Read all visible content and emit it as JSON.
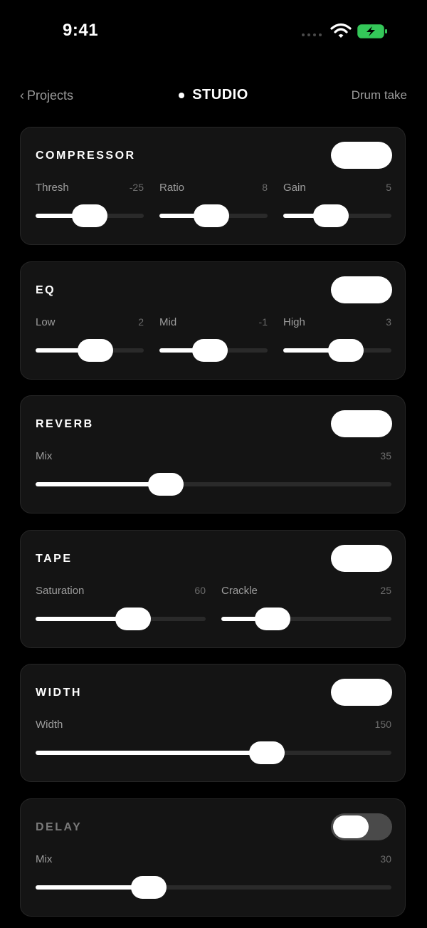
{
  "status_bar": {
    "time": "9:41"
  },
  "nav": {
    "back_label": "Projects",
    "title": "STUDIO",
    "right_label": "Drum take"
  },
  "modules": [
    {
      "title": "COMPRESSOR",
      "enabled": true,
      "params": [
        {
          "label": "Thresh",
          "value": "-25",
          "level": 0.5
        },
        {
          "label": "Ratio",
          "value": "8",
          "level": 0.48
        },
        {
          "label": "Gain",
          "value": "5",
          "level": 0.44
        }
      ]
    },
    {
      "title": "EQ",
      "enabled": true,
      "params": [
        {
          "label": "Low",
          "value": "2",
          "level": 0.55
        },
        {
          "label": "Mid",
          "value": "-1",
          "level": 0.47
        },
        {
          "label": "High",
          "value": "3",
          "level": 0.58
        }
      ]
    },
    {
      "title": "REVERB",
      "enabled": true,
      "params": [
        {
          "label": "Mix",
          "value": "35",
          "level": 0.366
        }
      ]
    },
    {
      "title": "TAPE",
      "enabled": true,
      "params": [
        {
          "label": "Saturation",
          "value": "60",
          "level": 0.575
        },
        {
          "label": "Crackle",
          "value": "25",
          "level": 0.3
        }
      ]
    },
    {
      "title": "WIDTH",
      "enabled": true,
      "params": [
        {
          "label": "Width",
          "value": "150",
          "level": 0.65
        }
      ]
    },
    {
      "title": "DELAY",
      "enabled": false,
      "params": [
        {
          "label": "Mix",
          "value": "30",
          "level": 0.318
        }
      ]
    }
  ],
  "colors": {
    "background": "#000000",
    "card": "#141414",
    "accent": "#ffffff",
    "battery": "#34c759"
  },
  "icons": [
    "signal-dots-icon",
    "wifi-icon",
    "battery-charging-icon",
    "chevron-left-icon"
  ]
}
